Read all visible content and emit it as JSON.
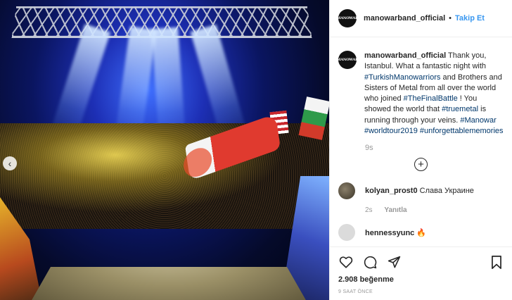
{
  "post": {
    "author": "manowarband_official",
    "avatar_text": "MANOWAR",
    "follow_label": "Takip Et",
    "caption_parts": [
      {
        "text": "Thank you, Istanbul. What a fantastic night with ",
        "tag": false
      },
      {
        "text": "#TurkishManowarriors",
        "tag": true
      },
      {
        "text": " and Brothers and Sisters of Metal from all over the world who joined ",
        "tag": false
      },
      {
        "text": "#TheFinalBattle",
        "tag": true
      },
      {
        "text": " ! You showed the world that ",
        "tag": false
      },
      {
        "text": "#truemetal",
        "tag": true
      },
      {
        "text": " is running through your veins. ",
        "tag": false
      },
      {
        "text": "#Manowar",
        "tag": true
      },
      {
        "text": " ",
        "tag": false
      },
      {
        "text": "#worldtour2019",
        "tag": true
      },
      {
        "text": " ",
        "tag": false
      },
      {
        "text": "#unforgettablememories",
        "tag": true
      }
    ],
    "caption_time": "9s",
    "likes": "2.908 beğenme",
    "time_ago": "9 SAAT ÖNCE"
  },
  "comments": [
    {
      "user": "kolyan_prost0",
      "text": "Слава Украине",
      "time": "2s",
      "reply_label": "Yanıtla"
    },
    {
      "user": "hennessyunc",
      "text": "🔥"
    }
  ],
  "icons": {
    "like": "heart-icon",
    "comment": "comment-icon",
    "share": "share-icon",
    "save": "bookmark-icon",
    "load_more": "plus-circle-icon",
    "prev": "chevron-left-icon"
  },
  "colors": {
    "link": "#3897f0",
    "hashtag": "#00376b",
    "muted": "#999999"
  }
}
